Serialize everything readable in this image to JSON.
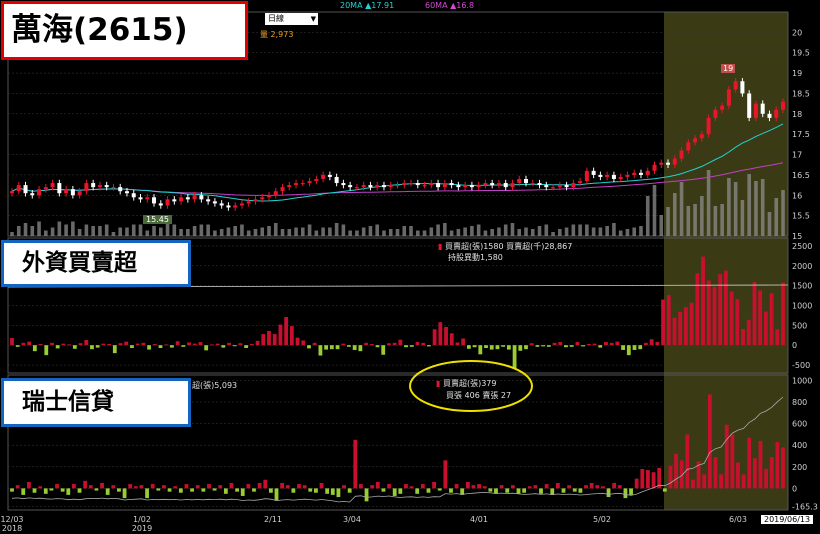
{
  "header": {
    "title": "萬海(2615)",
    "period": "日線",
    "ma20_label": "20MA ▲17.91",
    "ma60_label": "60MA ▲16.8",
    "volume_label": "量 2,973",
    "marker_low": "15.45",
    "marker_high": "19"
  },
  "panels": {
    "foreign": {
      "title": "外資買賣超",
      "info_line1": "買賣超(張)1580 買賣超(千)28,867",
      "info_line2": "持股異動1,580"
    },
    "credit": {
      "title": "瑞士信貸",
      "info_partial": "超(張)5,093",
      "popup_line1": "買賣超(張)379",
      "popup_line2": "買張 406 賣張 27"
    }
  },
  "x_labels": [
    {
      "text": "12/03",
      "sub": "2018"
    },
    {
      "text": "1/02",
      "sub": "2019"
    },
    {
      "text": "2/11",
      "sub": ""
    },
    {
      "text": "3/04",
      "sub": ""
    },
    {
      "text": "4/01",
      "sub": ""
    },
    {
      "text": "5/02",
      "sub": ""
    },
    {
      "text": "6/03",
      "sub": ""
    }
  ],
  "date_box": "2019/06/13",
  "colors": {
    "up": "#e8152b",
    "down": "#ffffff",
    "bar_pos": "#c8102e",
    "bar_neg": "#9acd32",
    "highlight": "#3a3a14",
    "ma20": "#22d3d3",
    "ma60": "#c040c8",
    "volume": "#8c8c8c",
    "grid": "#3a3a3a"
  },
  "chart_data": [
    {
      "type": "candlestick",
      "title": "萬海(2615)",
      "ylim": [
        15,
        20.5
      ],
      "y_ticks": [
        15,
        15.5,
        16,
        16.5,
        17,
        17.5,
        18,
        18.5,
        19,
        19.5,
        20
      ],
      "close": [
        16.1,
        16.25,
        16.05,
        16.0,
        16.15,
        16.2,
        16.3,
        16.05,
        16.15,
        16.0,
        16.1,
        16.3,
        16.2,
        16.25,
        16.2,
        16.2,
        16.1,
        16.05,
        15.95,
        15.9,
        15.95,
        15.8,
        15.75,
        15.9,
        15.85,
        15.95,
        15.9,
        16.0,
        15.9,
        15.85,
        15.8,
        15.75,
        15.7,
        15.75,
        15.8,
        15.85,
        15.9,
        15.95,
        16.0,
        16.1,
        16.2,
        16.25,
        16.3,
        16.3,
        16.35,
        16.4,
        16.5,
        16.45,
        16.3,
        16.25,
        16.2,
        16.2,
        16.25,
        16.2,
        16.25,
        16.2,
        16.25,
        16.25,
        16.3,
        16.3,
        16.25,
        16.25,
        16.3,
        16.2,
        16.3,
        16.25,
        16.2,
        16.25,
        16.2,
        16.25,
        16.3,
        16.25,
        16.3,
        16.2,
        16.3,
        16.4,
        16.3,
        16.3,
        16.25,
        16.2,
        16.2,
        16.25,
        16.2,
        16.3,
        16.35,
        16.6,
        16.5,
        16.45,
        16.5,
        16.4,
        16.45,
        16.5,
        16.55,
        16.5,
        16.6,
        16.75,
        16.8,
        16.75,
        16.9,
        17.1,
        17.3,
        17.4,
        17.5,
        17.9,
        18.1,
        18.2,
        18.6,
        18.8,
        18.5,
        17.9,
        18.25,
        18.0,
        17.9,
        18.1,
        18.3
      ],
      "ma20_visible": true,
      "ma60_visible": true,
      "volume": "shown as grey bars near bottom of price panel"
    },
    {
      "type": "bar",
      "title": "外資買賣超",
      "ylim": [
        -700,
        2700
      ],
      "y_ticks": [
        -500,
        0,
        500,
        1000,
        1500,
        2000,
        2500
      ],
      "values": [
        180,
        -40,
        60,
        90,
        -150,
        30,
        -250,
        60,
        -80,
        40,
        20,
        -90,
        50,
        130,
        -100,
        -60,
        40,
        30,
        -200,
        50,
        90,
        -70,
        40,
        60,
        -110,
        30,
        -70,
        20,
        -60,
        100,
        -40,
        70,
        40,
        80,
        -130,
        20,
        40,
        -60,
        60,
        -20,
        50,
        -70,
        30,
        110,
        280,
        360,
        280,
        520,
        710,
        480,
        190,
        120,
        -80,
        60,
        -260,
        -110,
        -100,
        -100,
        40,
        -40,
        -120,
        -150,
        60,
        30,
        -50,
        -240,
        50,
        60,
        140,
        -50,
        -40,
        80,
        60,
        -30,
        400,
        580,
        460,
        300,
        70,
        170,
        -90,
        -50,
        -230,
        -70,
        -110,
        -100,
        -40,
        -110,
        -590,
        -140,
        -100,
        50,
        -40,
        -30,
        -40,
        60,
        80,
        -50,
        -40,
        80,
        -30,
        30,
        40,
        -60,
        80,
        60,
        90,
        -120,
        -250,
        -120,
        -100,
        60,
        150,
        80,
        1150,
        1260,
        690,
        840,
        960,
        1070,
        1810,
        2230,
        1630,
        1470,
        1790,
        1880,
        1350,
        1160,
        410,
        640,
        1590,
        1380,
        850,
        1310,
        400,
        1580
      ]
    },
    {
      "type": "bar",
      "title": "瑞士信貸",
      "ylim": [
        -200,
        1050
      ],
      "y_ticks": [
        -165.3,
        0,
        200,
        400,
        600,
        800,
        1000
      ],
      "values": [
        -30,
        30,
        -60,
        60,
        -40,
        20,
        -50,
        -20,
        40,
        -30,
        -60,
        40,
        -40,
        70,
        30,
        -20,
        50,
        -60,
        30,
        -30,
        -90,
        40,
        20,
        30,
        -90,
        40,
        -20,
        30,
        -30,
        20,
        -40,
        40,
        -30,
        30,
        -30,
        40,
        -20,
        30,
        -50,
        50,
        -30,
        -70,
        40,
        -30,
        50,
        80,
        -40,
        -110,
        50,
        30,
        -40,
        40,
        30,
        -30,
        -40,
        50,
        -50,
        -60,
        -80,
        30,
        -40,
        450,
        40,
        -120,
        30,
        60,
        -30,
        40,
        -70,
        -50,
        40,
        20,
        -50,
        40,
        -40,
        60,
        -20,
        260,
        -40,
        40,
        -60,
        60,
        30,
        40,
        20,
        -30,
        -50,
        30,
        -40,
        30,
        -50,
        -40,
        20,
        30,
        -50,
        40,
        -60,
        50,
        -40,
        30,
        -30,
        -40,
        30,
        50,
        30,
        20,
        -80,
        50,
        30,
        -90,
        -60,
        90,
        180,
        170,
        150,
        190,
        -30,
        210,
        320,
        260,
        500,
        80,
        250,
        130,
        870,
        290,
        130,
        590,
        500,
        240,
        130,
        470,
        280,
        440,
        180,
        290,
        430,
        380
      ]
    }
  ]
}
